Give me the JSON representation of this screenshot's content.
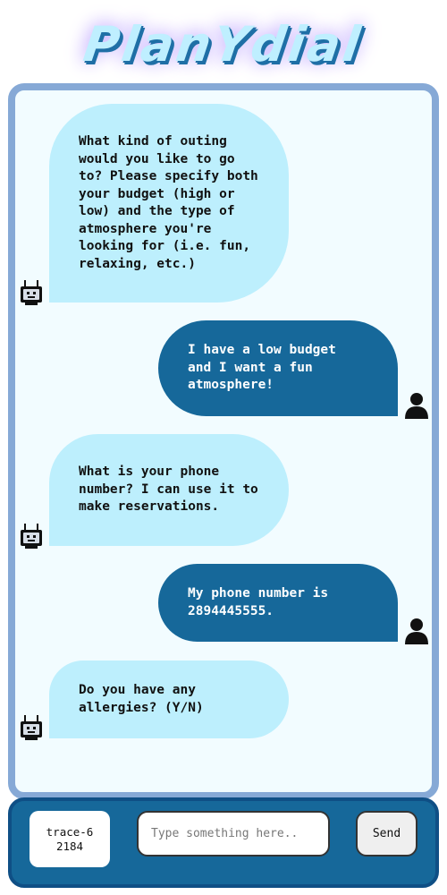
{
  "app": {
    "logo_text": "PlanYdial"
  },
  "messages": [
    {
      "sender": "bot",
      "text": "What kind of outing would you like to go to? Please specify both your budget (high or low) and the type of atmosphere you're looking for (i.e. fun, relaxing, etc.)"
    },
    {
      "sender": "user",
      "text": "I have a low budget and I want a fun atmosphere!"
    },
    {
      "sender": "bot",
      "text": "What is your phone number? I can use it to make reservations."
    },
    {
      "sender": "user",
      "text": "My phone number is 2894445555."
    },
    {
      "sender": "bot",
      "text": "Do you have any allergies? (Y/N)"
    }
  ],
  "input_bar": {
    "session_id": "trace-62184",
    "message_placeholder": "Type something here..",
    "message_value": "",
    "send_label": "Send"
  },
  "colors": {
    "bot_bubble": "#bdeffd",
    "user_bubble": "#16689a",
    "frame_border": "#86a9d6",
    "input_bar": "#16689a"
  },
  "icons": {
    "bot_avatar": "robot-icon",
    "user_avatar": "person-icon"
  }
}
